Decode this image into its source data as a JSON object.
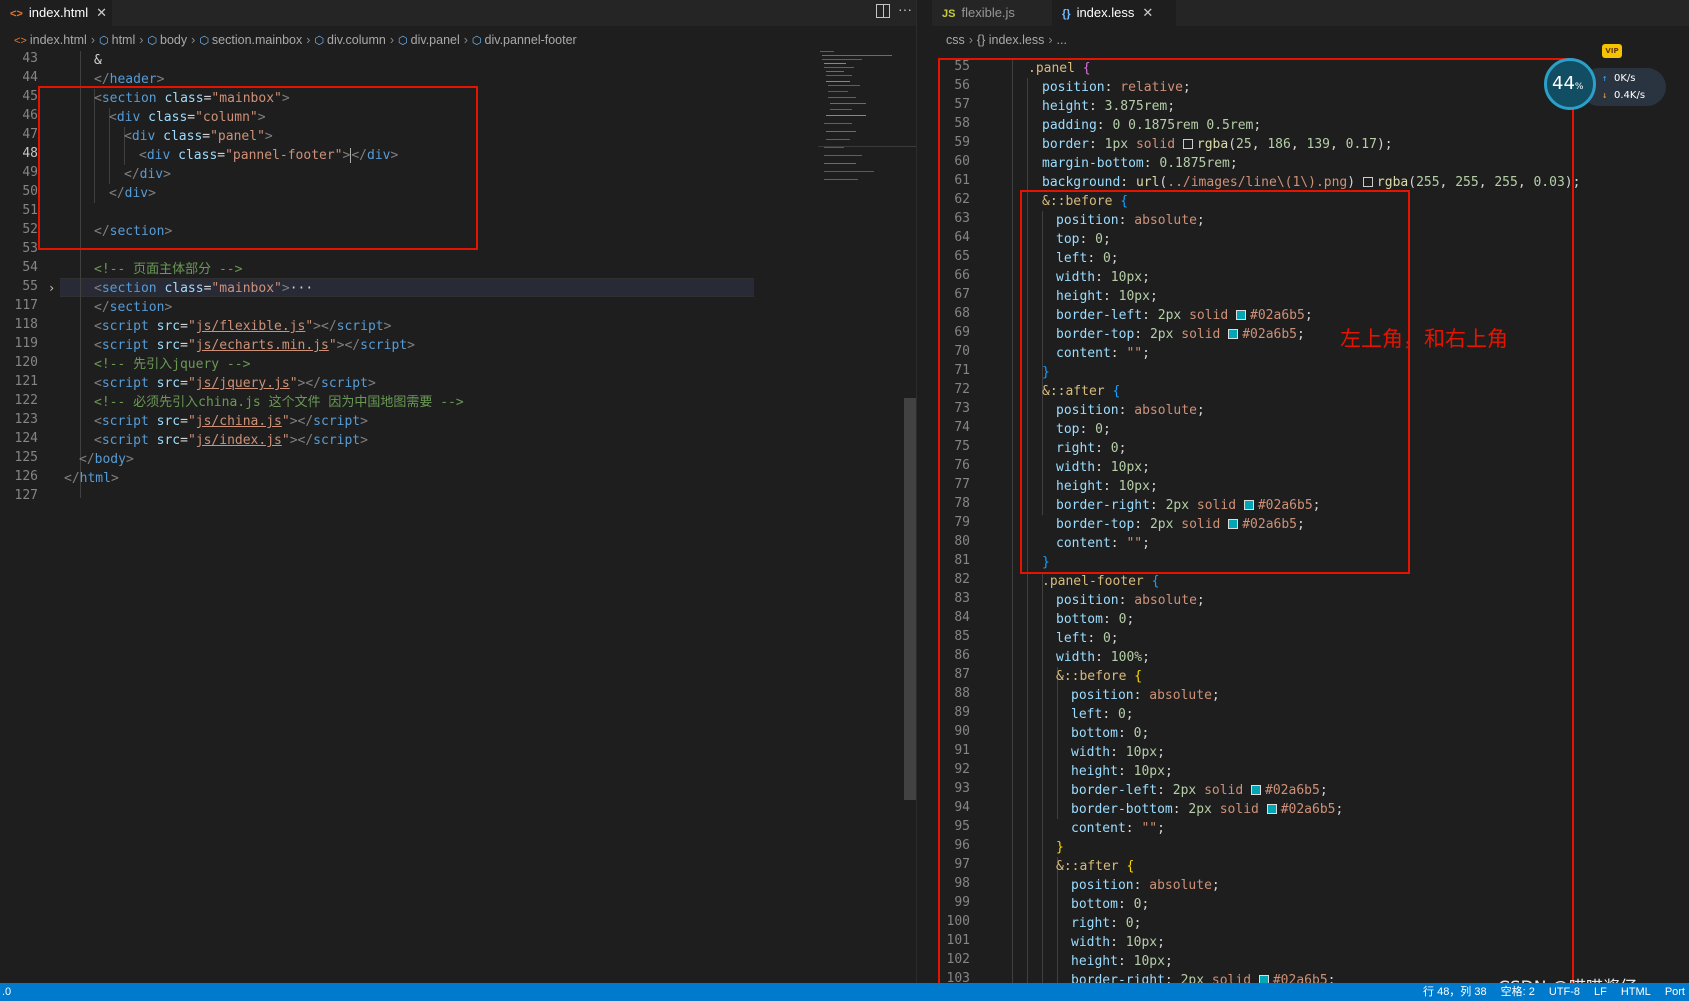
{
  "left_editor": {
    "tab": {
      "icon": "<>",
      "label": "index.html",
      "close": "✕"
    },
    "actions": [
      "split-editor-icon",
      "more-icon"
    ],
    "breadcrumbs": [
      "index.html",
      "html",
      "body",
      "section.mainbox",
      "div.column",
      "div.panel",
      "div.pannel-footer"
    ],
    "cursor_line": "48"
  },
  "right_editor": {
    "tabs": [
      {
        "icon": "JS",
        "label": "flexible.js"
      },
      {
        "icon": "{}",
        "label": "index.less",
        "close": "✕"
      }
    ],
    "breadcrumbs": [
      "css",
      "{} index.less",
      "..."
    ]
  },
  "annotation": "左上角，和右上角",
  "watermark": "CSDN @喵喵酱仔",
  "net_widget": {
    "percent": "44",
    "unit": "%",
    "up": "0K/s",
    "down": "0.4K/s",
    "badge": "VIP"
  },
  "status_bar": {
    "left": ".0",
    "items": [
      "行 48，列 38",
      "空格: 2",
      "UTF-8",
      "LF",
      "HTML",
      "Port"
    ]
  },
  "colors": {
    "accent": "#007acc",
    "annotation_red": "#e51400",
    "swatch_teal": "#02a6b5"
  }
}
